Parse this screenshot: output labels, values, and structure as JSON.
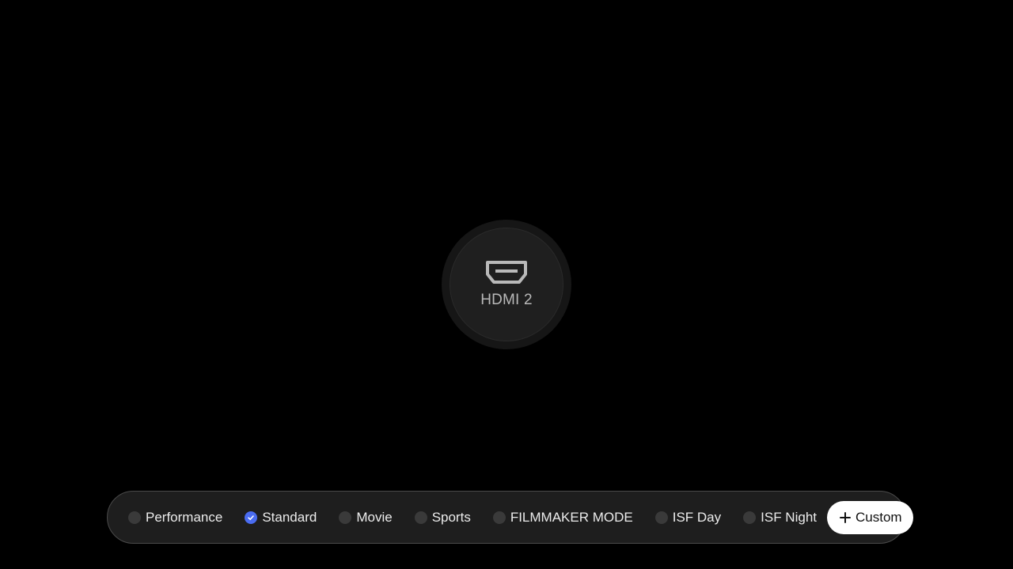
{
  "input": {
    "label": "HDMI 2",
    "icon": "hdmi-icon"
  },
  "picture_modes": {
    "items": [
      {
        "label": "Performance",
        "selected": false
      },
      {
        "label": "Standard",
        "selected": true
      },
      {
        "label": "Movie",
        "selected": false
      },
      {
        "label": "Sports",
        "selected": false
      },
      {
        "label": "FILMMAKER MODE",
        "selected": false
      },
      {
        "label": "ISF Day",
        "selected": false
      },
      {
        "label": "ISF Night",
        "selected": false
      }
    ],
    "custom_label": "Custom"
  },
  "colors": {
    "background": "#000000",
    "bar_background": "#1e1e1e",
    "selected_accent": "#4a6cf0",
    "custom_button_background": "#ffffff"
  }
}
